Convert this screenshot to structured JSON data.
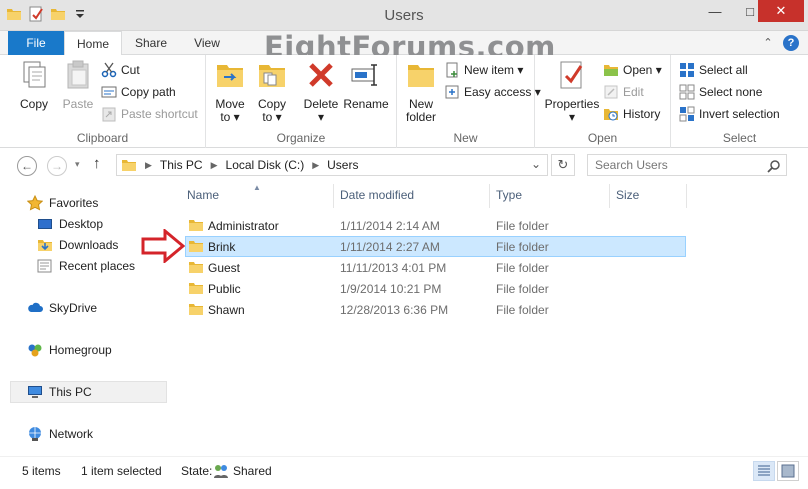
{
  "window": {
    "title": "Users",
    "minimize": "—",
    "maximize": "□",
    "close": "✕"
  },
  "watermark": "EightForums.com",
  "tabs": {
    "file": "File",
    "home": "Home",
    "share": "Share",
    "view": "View",
    "collapse": "⌃",
    "help": "?"
  },
  "ribbon": {
    "clipboard": {
      "label": "Clipboard",
      "copy": "Copy",
      "paste": "Paste",
      "cut": "Cut",
      "copy_path": "Copy path",
      "paste_shortcut": "Paste shortcut"
    },
    "organize": {
      "label": "Organize",
      "move_to": "Move",
      "move_to2": "to ▾",
      "copy_to": "Copy",
      "copy_to2": "to ▾"
    },
    "delete": {
      "delete": "Delete",
      "delete2": "▾",
      "rename": "Rename"
    },
    "new": {
      "label": "New",
      "new_folder": "New",
      "new_folder2": "folder",
      "new_item": "New item ▾",
      "easy_access": "Easy access ▾"
    },
    "open": {
      "label": "Open",
      "properties": "Properties",
      "properties2": "▾",
      "open": "Open ▾",
      "edit": "Edit",
      "history": "History"
    },
    "select": {
      "label": "Select",
      "select_all": "Select all",
      "select_none": "Select none",
      "invert": "Invert selection"
    }
  },
  "address": {
    "back": "←",
    "forward": "→",
    "up": "↑",
    "crumbs": [
      "This PC",
      "Local Disk (C:)",
      "Users"
    ],
    "dropdown": "⌄",
    "refresh": "↻",
    "search_placeholder": "Search Users",
    "search_icon": "search-icon"
  },
  "nav": {
    "favorites": "Favorites",
    "desktop": "Desktop",
    "downloads": "Downloads",
    "recent": "Recent places",
    "skydrive": "SkyDrive",
    "homegroup": "Homegroup",
    "thispc": "This PC",
    "network": "Network"
  },
  "columns": {
    "name": "Name",
    "date": "Date modified",
    "type": "Type",
    "size": "Size"
  },
  "rows": [
    {
      "name": "Administrator",
      "date": "1/11/2014 2:14 AM",
      "type": "File folder"
    },
    {
      "name": "Brink",
      "date": "1/11/2014 2:27 AM",
      "type": "File folder"
    },
    {
      "name": "Guest",
      "date": "11/11/2013 4:01 PM",
      "type": "File folder"
    },
    {
      "name": "Public",
      "date": "1/9/2014 10:21 PM",
      "type": "File folder"
    },
    {
      "name": "Shawn",
      "date": "12/28/2013 6:36 PM",
      "type": "File folder"
    }
  ],
  "status": {
    "items": "5 items",
    "selected": "1 item selected",
    "state_label": "State:",
    "state_value": "Shared"
  },
  "colors": {
    "accent": "#1979ca",
    "selection": "#cce8ff",
    "close": "#c7312b",
    "arrow": "#d4242a"
  }
}
